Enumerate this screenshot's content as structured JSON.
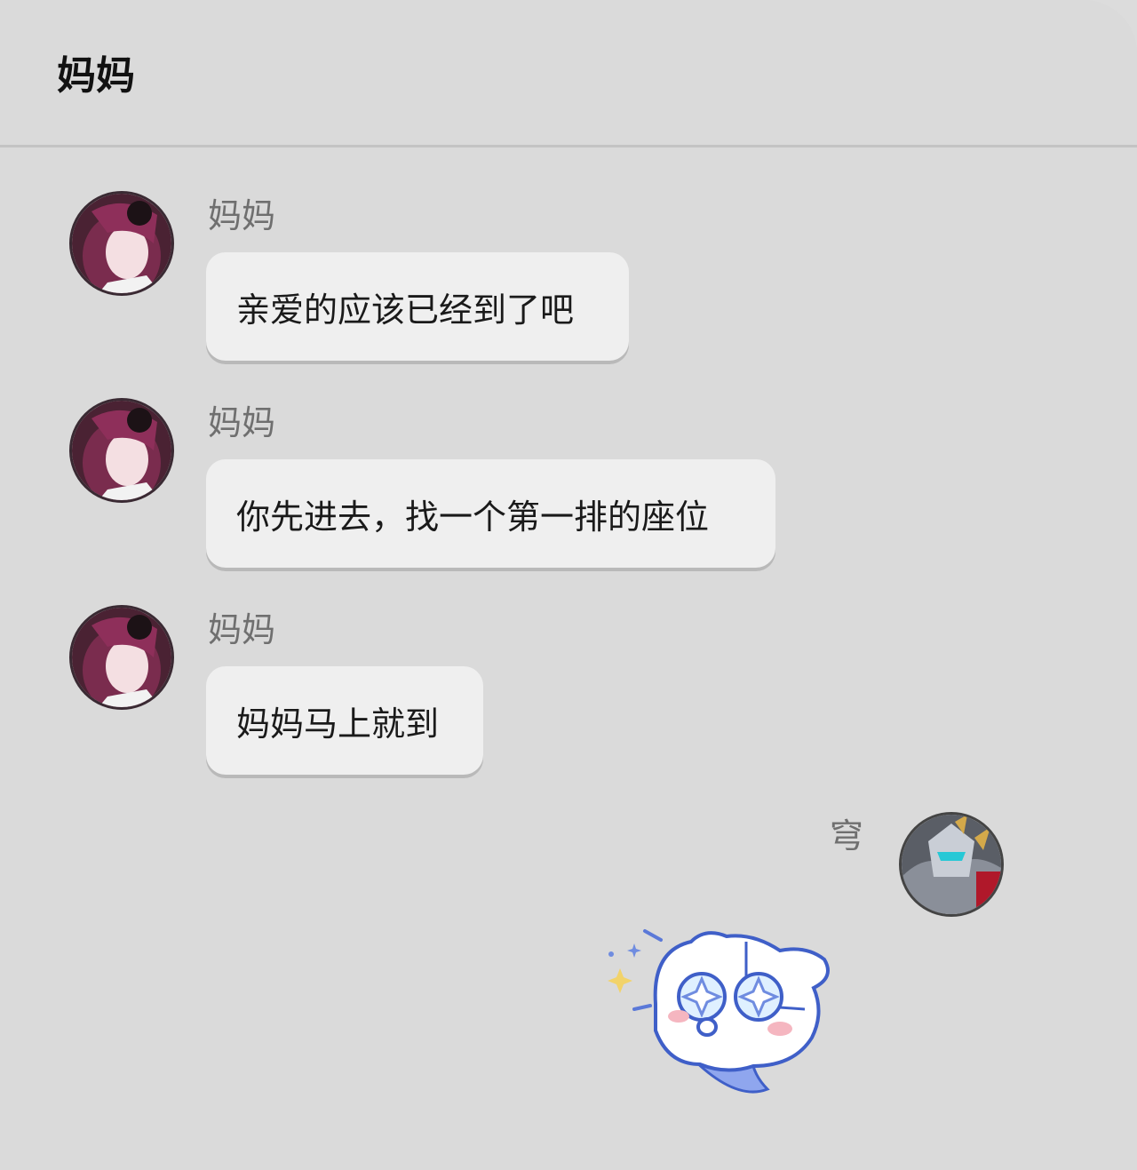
{
  "header": {
    "title": "妈妈"
  },
  "messages": [
    {
      "sender": "妈妈",
      "avatar_icon": "mom-avatar",
      "text": "亲爱的应该已经到了吧"
    },
    {
      "sender": "妈妈",
      "avatar_icon": "mom-avatar",
      "text": "你先进去，找一个第一排的座位"
    },
    {
      "sender": "妈妈",
      "avatar_icon": "mom-avatar",
      "text": "妈妈马上就到"
    }
  ],
  "self_message": {
    "sender": "穹",
    "avatar_icon": "self-avatar",
    "sticker_icon": "ghost-sticker"
  },
  "colors": {
    "background": "#dadada",
    "bubble": "#efefef",
    "name_text": "#6f6f6f",
    "title_text": "#111111"
  }
}
